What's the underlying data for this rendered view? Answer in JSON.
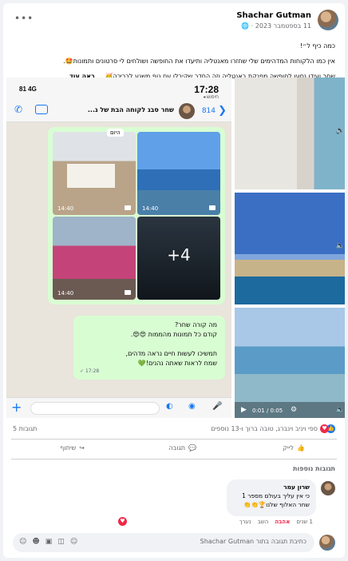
{
  "post": {
    "author": "Shachar Gutman",
    "date": "11 בספטמבר 2023 · ",
    "privacy_icon": "globe-icon",
    "lines": [
      "כמה כיף ל״!",
      "אין כמו הלקוחות המדהימים שלי שחזרו מאנטליה ותיעדו את החופשה ושולחים לי סרטונים ותמונות🤩.",
      "שחר ועידו נסעו לחופשה מפנקת באנטליה וזה החדר שקיבלו עם נוף משגע לבריכה🥳.... "
    ],
    "see_more": "ראה עוד"
  },
  "screenshot": {
    "time": "17:28",
    "signal": "4G",
    "battery": "81",
    "back_label": "◂ חיפוש",
    "member_count": "814",
    "group_name": "שחר סבג לקוחה הבת של ג...",
    "today_label": "היום",
    "photo_times": [
      "14:40",
      "14:40",
      "14:40"
    ],
    "more_count": "+4",
    "message_lines": [
      "מה קורה שחר?",
      "קודם כל תמונות מהממות 😍😍.",
      "",
      "תמשיכו לעשות חיים נראה מדהים,",
      "שמח לראות שאתה נהנים!💚"
    ],
    "message_time": "17:28 ✓"
  },
  "video": {
    "time": "0:01 / 0:05"
  },
  "reactions": {
    "names": "ספי ויניב וינברג, טובה ברוך ו-13 נוספים",
    "comments": "5 תגובות"
  },
  "actions": {
    "like": "לייק",
    "comment": "תגובה",
    "share": "שיתוף"
  },
  "more_comments": "תגובות נוספות",
  "comment": {
    "author": "שרון עמר",
    "lines": [
      "כי אין עליך בעולם מספר 1",
      "שחר האלוף שלנו🏆👏👏"
    ],
    "time": "1 שנים",
    "love": "אהבה",
    "reply": "השב",
    "edited": "נערך"
  },
  "reply_placeholder": "כתיבת תגובה בתור Shachar Gutman"
}
